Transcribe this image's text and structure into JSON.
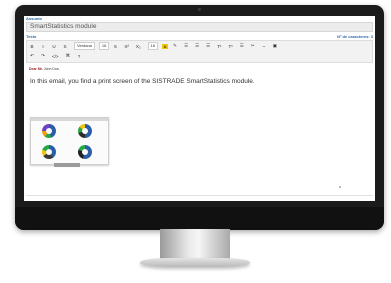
{
  "email": {
    "subject_label": "Assunto",
    "subject_value": "SmartStatistics module",
    "body_label": "Texto",
    "char_count_label": "Nº de caracteres: 3",
    "greeting_prefix": "Dear Mr.",
    "greeting_name": "John Doe,",
    "message": "In this email, you find a print screen of the SISTRADE SmartStatistics module."
  },
  "toolbar": {
    "row1": [
      "B",
      "I",
      "U",
      "S",
      "Verdana",
      "16",
      "S",
      "X²",
      "X₂",
      "16",
      "A",
      "✎",
      "☰",
      "☰",
      "☰",
      "T¹",
      "T¹",
      "☰",
      "✂",
      "~",
      "▣"
    ],
    "row2": [
      "↶",
      "↷",
      "</>",
      "⌘",
      "?"
    ]
  },
  "colors": {
    "accent": "#2e6aa6",
    "bezel": "#1b1b1b"
  }
}
